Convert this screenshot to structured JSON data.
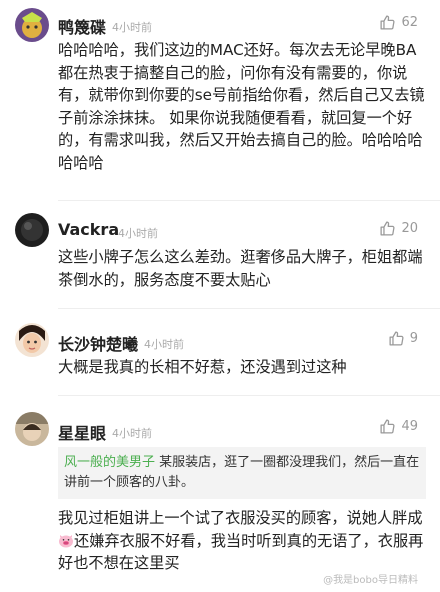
{
  "comments": [
    {
      "username": "鸭篾碟",
      "time": "4小时前",
      "likes": "62",
      "text": "哈哈哈哈，我们这边的MAC还好。每次去无论早晚BA都在热衷于搞整自己的脸，问你有没有需要的，你说有，就带你到你要的se号前指给你看，然后自己又去镜子前涂涂抹抹。 如果你说我随便看看，就回复一个好的，有需求叫我，然后又开始去搞自己的脸。哈哈哈哈哈哈哈"
    },
    {
      "username": "Vackra",
      "time": "4小时前",
      "likes": "20",
      "text": "这些小牌子怎么这么差劲。逛奢侈品大牌子，柜姐都端茶倒水的，服务态度不要太贴心"
    },
    {
      "username": "长沙钟楚曦",
      "time": "4小时前",
      "likes": "9",
      "text": "大概是我真的长相不好惹，还没遇到过这种"
    },
    {
      "username": "星星眼",
      "time": "4小时前",
      "likes": "49",
      "quote_name": "风一般的美男子",
      "quote_text": " 某服装店，逛了一圈都没理我们，然后一直在讲前一个顾客的八卦。",
      "text_a": "我见过柜姐讲上一个试了衣服没买的顾客，说她人胖成",
      "text_b": "还嫌弃衣服不好看，我当时听到真的无语了，衣服再好也不想在这里买"
    }
  ],
  "watermark": "@我是bobo导日精料",
  "icons": {
    "like": "thumbs-up-icon",
    "emoji": "pig-face-emoji"
  }
}
